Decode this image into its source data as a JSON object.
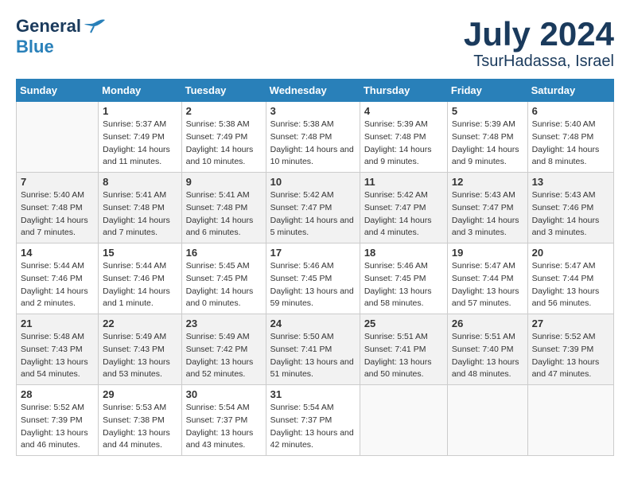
{
  "header": {
    "logo_general": "General",
    "logo_blue": "Blue",
    "month_title": "July 2024",
    "location": "TsurHadassa, Israel"
  },
  "days_of_week": [
    "Sunday",
    "Monday",
    "Tuesday",
    "Wednesday",
    "Thursday",
    "Friday",
    "Saturday"
  ],
  "weeks": [
    [
      {
        "num": "",
        "sunrise": "",
        "sunset": "",
        "daylight": ""
      },
      {
        "num": "1",
        "sunrise": "Sunrise: 5:37 AM",
        "sunset": "Sunset: 7:49 PM",
        "daylight": "Daylight: 14 hours and 11 minutes."
      },
      {
        "num": "2",
        "sunrise": "Sunrise: 5:38 AM",
        "sunset": "Sunset: 7:49 PM",
        "daylight": "Daylight: 14 hours and 10 minutes."
      },
      {
        "num": "3",
        "sunrise": "Sunrise: 5:38 AM",
        "sunset": "Sunset: 7:48 PM",
        "daylight": "Daylight: 14 hours and 10 minutes."
      },
      {
        "num": "4",
        "sunrise": "Sunrise: 5:39 AM",
        "sunset": "Sunset: 7:48 PM",
        "daylight": "Daylight: 14 hours and 9 minutes."
      },
      {
        "num": "5",
        "sunrise": "Sunrise: 5:39 AM",
        "sunset": "Sunset: 7:48 PM",
        "daylight": "Daylight: 14 hours and 9 minutes."
      },
      {
        "num": "6",
        "sunrise": "Sunrise: 5:40 AM",
        "sunset": "Sunset: 7:48 PM",
        "daylight": "Daylight: 14 hours and 8 minutes."
      }
    ],
    [
      {
        "num": "7",
        "sunrise": "Sunrise: 5:40 AM",
        "sunset": "Sunset: 7:48 PM",
        "daylight": "Daylight: 14 hours and 7 minutes."
      },
      {
        "num": "8",
        "sunrise": "Sunrise: 5:41 AM",
        "sunset": "Sunset: 7:48 PM",
        "daylight": "Daylight: 14 hours and 7 minutes."
      },
      {
        "num": "9",
        "sunrise": "Sunrise: 5:41 AM",
        "sunset": "Sunset: 7:48 PM",
        "daylight": "Daylight: 14 hours and 6 minutes."
      },
      {
        "num": "10",
        "sunrise": "Sunrise: 5:42 AM",
        "sunset": "Sunset: 7:47 PM",
        "daylight": "Daylight: 14 hours and 5 minutes."
      },
      {
        "num": "11",
        "sunrise": "Sunrise: 5:42 AM",
        "sunset": "Sunset: 7:47 PM",
        "daylight": "Daylight: 14 hours and 4 minutes."
      },
      {
        "num": "12",
        "sunrise": "Sunrise: 5:43 AM",
        "sunset": "Sunset: 7:47 PM",
        "daylight": "Daylight: 14 hours and 3 minutes."
      },
      {
        "num": "13",
        "sunrise": "Sunrise: 5:43 AM",
        "sunset": "Sunset: 7:46 PM",
        "daylight": "Daylight: 14 hours and 3 minutes."
      }
    ],
    [
      {
        "num": "14",
        "sunrise": "Sunrise: 5:44 AM",
        "sunset": "Sunset: 7:46 PM",
        "daylight": "Daylight: 14 hours and 2 minutes."
      },
      {
        "num": "15",
        "sunrise": "Sunrise: 5:44 AM",
        "sunset": "Sunset: 7:46 PM",
        "daylight": "Daylight: 14 hours and 1 minute."
      },
      {
        "num": "16",
        "sunrise": "Sunrise: 5:45 AM",
        "sunset": "Sunset: 7:45 PM",
        "daylight": "Daylight: 14 hours and 0 minutes."
      },
      {
        "num": "17",
        "sunrise": "Sunrise: 5:46 AM",
        "sunset": "Sunset: 7:45 PM",
        "daylight": "Daylight: 13 hours and 59 minutes."
      },
      {
        "num": "18",
        "sunrise": "Sunrise: 5:46 AM",
        "sunset": "Sunset: 7:45 PM",
        "daylight": "Daylight: 13 hours and 58 minutes."
      },
      {
        "num": "19",
        "sunrise": "Sunrise: 5:47 AM",
        "sunset": "Sunset: 7:44 PM",
        "daylight": "Daylight: 13 hours and 57 minutes."
      },
      {
        "num": "20",
        "sunrise": "Sunrise: 5:47 AM",
        "sunset": "Sunset: 7:44 PM",
        "daylight": "Daylight: 13 hours and 56 minutes."
      }
    ],
    [
      {
        "num": "21",
        "sunrise": "Sunrise: 5:48 AM",
        "sunset": "Sunset: 7:43 PM",
        "daylight": "Daylight: 13 hours and 54 minutes."
      },
      {
        "num": "22",
        "sunrise": "Sunrise: 5:49 AM",
        "sunset": "Sunset: 7:43 PM",
        "daylight": "Daylight: 13 hours and 53 minutes."
      },
      {
        "num": "23",
        "sunrise": "Sunrise: 5:49 AM",
        "sunset": "Sunset: 7:42 PM",
        "daylight": "Daylight: 13 hours and 52 minutes."
      },
      {
        "num": "24",
        "sunrise": "Sunrise: 5:50 AM",
        "sunset": "Sunset: 7:41 PM",
        "daylight": "Daylight: 13 hours and 51 minutes."
      },
      {
        "num": "25",
        "sunrise": "Sunrise: 5:51 AM",
        "sunset": "Sunset: 7:41 PM",
        "daylight": "Daylight: 13 hours and 50 minutes."
      },
      {
        "num": "26",
        "sunrise": "Sunrise: 5:51 AM",
        "sunset": "Sunset: 7:40 PM",
        "daylight": "Daylight: 13 hours and 48 minutes."
      },
      {
        "num": "27",
        "sunrise": "Sunrise: 5:52 AM",
        "sunset": "Sunset: 7:39 PM",
        "daylight": "Daylight: 13 hours and 47 minutes."
      }
    ],
    [
      {
        "num": "28",
        "sunrise": "Sunrise: 5:52 AM",
        "sunset": "Sunset: 7:39 PM",
        "daylight": "Daylight: 13 hours and 46 minutes."
      },
      {
        "num": "29",
        "sunrise": "Sunrise: 5:53 AM",
        "sunset": "Sunset: 7:38 PM",
        "daylight": "Daylight: 13 hours and 44 minutes."
      },
      {
        "num": "30",
        "sunrise": "Sunrise: 5:54 AM",
        "sunset": "Sunset: 7:37 PM",
        "daylight": "Daylight: 13 hours and 43 minutes."
      },
      {
        "num": "31",
        "sunrise": "Sunrise: 5:54 AM",
        "sunset": "Sunset: 7:37 PM",
        "daylight": "Daylight: 13 hours and 42 minutes."
      },
      {
        "num": "",
        "sunrise": "",
        "sunset": "",
        "daylight": ""
      },
      {
        "num": "",
        "sunrise": "",
        "sunset": "",
        "daylight": ""
      },
      {
        "num": "",
        "sunrise": "",
        "sunset": "",
        "daylight": ""
      }
    ]
  ]
}
